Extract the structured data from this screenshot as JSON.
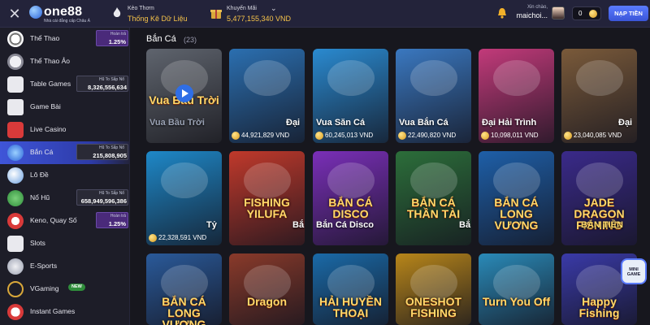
{
  "header": {
    "close_icon": "close-icon",
    "logo_text": "one88",
    "logo_sub": "Nhà cái đẳng cấp Châu Á",
    "keo_thom_label": "Kèo Thơm",
    "keo_thom_value": "Thống Kê Dữ Liệu",
    "khuyen_mai_label": "Khuyến Mãi",
    "khuyen_mai_value": "5,477,155,340 VND",
    "greeting": "Xin chào,",
    "username": "maichoi...",
    "balance": "0",
    "deposit_label": "NẠP TIỀN"
  },
  "sidebar": {
    "items": [
      {
        "label": "Thể Thao",
        "icon": "soccer-ball-icon",
        "jackpot_title": "Hoàn trả",
        "jackpot_value": "1.25%"
      },
      {
        "label": "Thể Thao Ảo",
        "icon": "virtual-sports-icon"
      },
      {
        "label": "Table Games",
        "icon": "dice-icon",
        "jackpot_title": "Hũ To Sắp Nổ",
        "jackpot_value": "8,326,556,634"
      },
      {
        "label": "Game Bài",
        "icon": "cards-icon"
      },
      {
        "label": "Live Casino",
        "icon": "live-casino-icon"
      },
      {
        "label": "Bắn Cá",
        "icon": "fish-icon",
        "jackpot_title": "Hũ To Sắp Nổ",
        "jackpot_value": "215,808,905"
      },
      {
        "label": "Lô Đề",
        "icon": "lottery-icon"
      },
      {
        "label": "Nổ Hũ",
        "icon": "jackpot-icon",
        "jackpot_title": "Hũ To Sắp Nổ",
        "jackpot_value": "658,949,596,386"
      },
      {
        "label": "Keno, Quay Số",
        "icon": "keno-icon",
        "jackpot_title": "Hoàn trả",
        "jackpot_value": "1.25%"
      },
      {
        "label": "Slots",
        "icon": "slots-icon"
      },
      {
        "label": "E-Sports",
        "icon": "esports-icon"
      },
      {
        "label": "VGaming",
        "icon": "vgaming-icon",
        "badge": "NEW"
      },
      {
        "label": "Instant Games",
        "icon": "instant-games-icon"
      }
    ]
  },
  "main": {
    "title": "Bắn Cá",
    "count": "(23)",
    "cards": [
      {
        "title": "Vua Bầu Trời",
        "jackpot": "",
        "art": "Vua Bầu Trời",
        "bg": "#5a6478",
        "active": false
      },
      {
        "title": "Đại",
        "jackpot": "44,921,829 VND",
        "art": "",
        "bg": "#2b6fb0",
        "active": true
      },
      {
        "title": "Vua Săn Cá",
        "jackpot": "60,245,013 VND",
        "art": "",
        "bg": "#2a8ad0",
        "active": true
      },
      {
        "title": "Vua Bắn Cá",
        "jackpot": "22,490,820 VND",
        "art": "",
        "bg": "#3a78c0",
        "active": true
      },
      {
        "title": "Đại Hải Trình",
        "jackpot": "10,098,011 VND",
        "art": "",
        "bg": "#c23a7a",
        "active": true
      },
      {
        "title": "Đại",
        "jackpot": "23,040,085 VND",
        "art": "",
        "bg": "#7a5a3a",
        "active": true
      },
      {
        "title": "Tỷ",
        "jackpot": "22,328,591 VND",
        "art": "",
        "bg": "#1e88c8",
        "active": true
      },
      {
        "title": "Bắ",
        "jackpot": "",
        "art": "FISHING YILUFA",
        "bg": "#c0392b",
        "active": true
      },
      {
        "title": "Bắn Cá Disco",
        "jackpot": "",
        "art": "BẮN CÁ DISCO",
        "bg": "#7a2fb8",
        "active": true
      },
      {
        "title": "Bắ",
        "jackpot": "",
        "art": "BẮN CÁ THẦN TÀI",
        "bg": "#2c6e3a",
        "active": true
      },
      {
        "title": "",
        "jackpot": "",
        "art": "BẮN CÁ LONG VƯƠNG",
        "bg": "#1e5fa8",
        "active": true
      },
      {
        "title": "BẮN TIỀN",
        "jackpot": "",
        "art": "JADE DRAGON FISHING",
        "bg": "#3a2a8a",
        "active": true
      },
      {
        "title": "",
        "jackpot": "",
        "art": "BẮN CÁ LONG VƯƠNG",
        "bg": "#2a5a9a",
        "active": true
      },
      {
        "title": "",
        "jackpot": "",
        "art": "Dragon",
        "bg": "#8a3a2a",
        "active": true
      },
      {
        "title": "",
        "jackpot": "",
        "art": "HẢI HUYỀN THOẠI",
        "bg": "#1a6aa8",
        "active": true
      },
      {
        "title": "",
        "jackpot": "",
        "art": "ONESHOT FISHING",
        "bg": "#b8861a",
        "active": true
      },
      {
        "title": "",
        "jackpot": "",
        "art": "Turn You Off",
        "bg": "#2a8ab8",
        "active": true
      },
      {
        "title": "",
        "jackpot": "",
        "art": "Happy Fishing",
        "bg": "#3a3aa8",
        "active": true
      }
    ]
  },
  "floating": {
    "label": "MINI GAME"
  }
}
